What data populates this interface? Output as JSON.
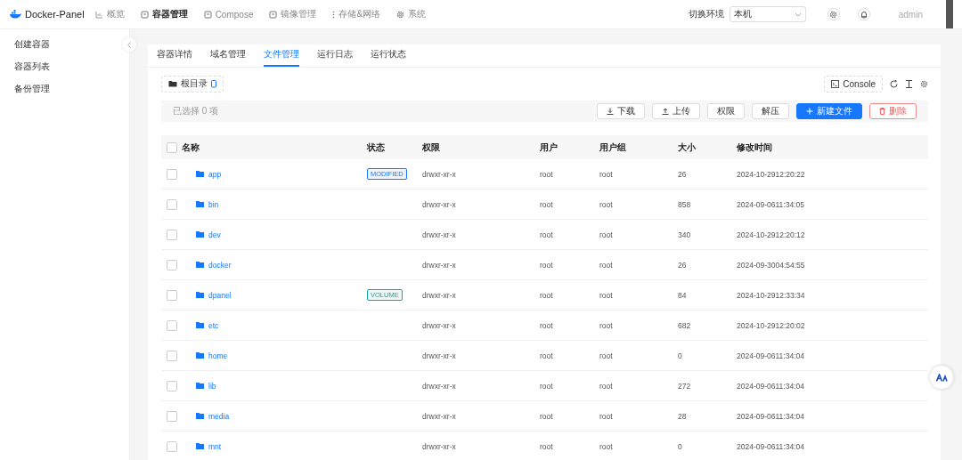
{
  "brand": "Docker-Panel",
  "nav": [
    {
      "label": "概览",
      "selected": false
    },
    {
      "label": "容器管理",
      "selected": true
    },
    {
      "label": "Compose",
      "selected": false
    },
    {
      "label": "镜像管理",
      "selected": false
    },
    {
      "label": "存储&网络",
      "selected": false
    },
    {
      "label": "系统",
      "selected": false
    }
  ],
  "env": {
    "label": "切换环境",
    "value": "本机"
  },
  "user": "admin",
  "sidebar": {
    "items": [
      "创建容器",
      "容器列表",
      "备份管理"
    ]
  },
  "tabs": [
    {
      "label": "容器详情",
      "selected": false
    },
    {
      "label": "域名管理",
      "selected": false
    },
    {
      "label": "文件管理",
      "selected": true
    },
    {
      "label": "运行日志",
      "selected": false
    },
    {
      "label": "运行状态",
      "selected": false
    }
  ],
  "path_button": "根目录",
  "console_button": "Console",
  "selection": {
    "prefix": "已选择",
    "count": "0",
    "suffix": "项"
  },
  "actions": [
    {
      "label": "下载",
      "kind": "download"
    },
    {
      "label": "上传",
      "kind": "upload"
    },
    {
      "label": "权限",
      "kind": "plain"
    },
    {
      "label": "解压",
      "kind": "plain"
    },
    {
      "label": "新建文件",
      "kind": "primary"
    },
    {
      "label": "删除",
      "kind": "danger"
    }
  ],
  "table": {
    "select_all": {
      "checked": false
    },
    "columns": [
      "名称",
      "状态",
      "权限",
      "用户",
      "用户组",
      "大小",
      "修改时间"
    ],
    "rows": [
      {
        "name": "app",
        "tag": {
          "text": "MODIFIED",
          "color": "#1677ff"
        },
        "perm": "drwxr-xr-x",
        "user": "root",
        "group": "root",
        "size": "26",
        "mtime": "2024-10-2912:20:22",
        "checked": false
      },
      {
        "name": "bin",
        "perm": "drwxr-xr-x",
        "user": "root",
        "group": "root",
        "size": "858",
        "mtime": "2024-09-0611:34:05",
        "checked": false
      },
      {
        "name": "dev",
        "perm": "drwxr-xr-x",
        "user": "root",
        "group": "root",
        "size": "340",
        "mtime": "2024-10-2912:20:12",
        "checked": false
      },
      {
        "name": "docker",
        "perm": "drwxr-xr-x",
        "user": "root",
        "group": "root",
        "size": "26",
        "mtime": "2024-09-3004:54:55",
        "checked": false
      },
      {
        "name": "dpanel",
        "tag": {
          "text": "VOLUME",
          "color": "#13a8a8"
        },
        "perm": "drwxr-xr-x",
        "user": "root",
        "group": "root",
        "size": "84",
        "mtime": "2024-10-2912:33:34",
        "checked": false
      },
      {
        "name": "etc",
        "perm": "drwxr-xr-x",
        "user": "root",
        "group": "root",
        "size": "682",
        "mtime": "2024-10-2912:20:02",
        "checked": false
      },
      {
        "name": "home",
        "perm": "drwxr-xr-x",
        "user": "root",
        "group": "root",
        "size": "0",
        "mtime": "2024-09-0611:34:04",
        "checked": false
      },
      {
        "name": "lib",
        "perm": "drwxr-xr-x",
        "user": "root",
        "group": "root",
        "size": "272",
        "mtime": "2024-09-0611:34:04",
        "checked": false
      },
      {
        "name": "media",
        "perm": "drwxr-xr-x",
        "user": "root",
        "group": "root",
        "size": "28",
        "mtime": "2024-09-0611:34:04",
        "checked": false
      },
      {
        "name": "mnt",
        "perm": "drwxr-xr-x",
        "user": "root",
        "group": "root",
        "size": "0",
        "mtime": "2024-09-0611:34:04",
        "checked": false
      }
    ]
  }
}
